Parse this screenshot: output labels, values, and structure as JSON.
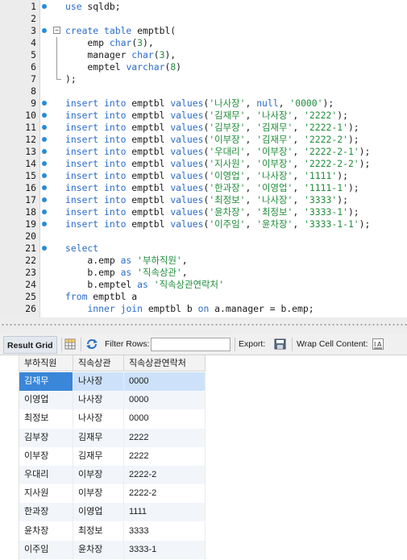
{
  "editor": {
    "lines": [
      {
        "n": "1",
        "dot": true,
        "tokens": [
          [
            "kw",
            "use"
          ],
          [
            "pl",
            " sqldb;"
          ]
        ]
      },
      {
        "n": "2",
        "dot": false,
        "tokens": []
      },
      {
        "n": "3",
        "dot": true,
        "fold": "−",
        "tokens": [
          [
            "kw",
            "create table"
          ],
          [
            "pl",
            " emptbl("
          ]
        ]
      },
      {
        "n": "4",
        "dot": false,
        "tokens": [
          [
            "pl",
            "    emp "
          ],
          [
            "kw",
            "char"
          ],
          [
            "pl",
            "("
          ],
          [
            "str",
            "3"
          ],
          [
            "pl",
            "),"
          ]
        ]
      },
      {
        "n": "5",
        "dot": false,
        "tokens": [
          [
            "pl",
            "    manager "
          ],
          [
            "kw",
            "char"
          ],
          [
            "pl",
            "("
          ],
          [
            "str",
            "3"
          ],
          [
            "pl",
            "),"
          ]
        ]
      },
      {
        "n": "6",
        "dot": false,
        "tokens": [
          [
            "pl",
            "    emptel "
          ],
          [
            "kw",
            "varchar"
          ],
          [
            "pl",
            "("
          ],
          [
            "str",
            "8"
          ],
          [
            "pl",
            ")"
          ]
        ]
      },
      {
        "n": "7",
        "dot": false,
        "tokens": [
          [
            "pl",
            ");"
          ]
        ]
      },
      {
        "n": "8",
        "dot": false,
        "tokens": []
      },
      {
        "n": "9",
        "dot": true,
        "tokens": [
          [
            "kw",
            "insert into"
          ],
          [
            "pl",
            " emptbl "
          ],
          [
            "kw",
            "values"
          ],
          [
            "pl",
            "("
          ],
          [
            "str",
            "'나사장'"
          ],
          [
            "pl",
            ", "
          ],
          [
            "kw",
            "null"
          ],
          [
            "pl",
            ", "
          ],
          [
            "str",
            "'0000'"
          ],
          [
            "pl",
            ");"
          ]
        ]
      },
      {
        "n": "10",
        "dot": true,
        "tokens": [
          [
            "kw",
            "insert into"
          ],
          [
            "pl",
            " emptbl "
          ],
          [
            "kw",
            "values"
          ],
          [
            "pl",
            "("
          ],
          [
            "str",
            "'김재무'"
          ],
          [
            "pl",
            ", "
          ],
          [
            "str",
            "'나사장'"
          ],
          [
            "pl",
            ", "
          ],
          [
            "str",
            "'2222'"
          ],
          [
            "pl",
            ");"
          ]
        ]
      },
      {
        "n": "11",
        "dot": true,
        "tokens": [
          [
            "kw",
            "insert into"
          ],
          [
            "pl",
            " emptbl "
          ],
          [
            "kw",
            "values"
          ],
          [
            "pl",
            "("
          ],
          [
            "str",
            "'김부장'"
          ],
          [
            "pl",
            ", "
          ],
          [
            "str",
            "'김재무'"
          ],
          [
            "pl",
            ", "
          ],
          [
            "str",
            "'2222-1'"
          ],
          [
            "pl",
            ");"
          ]
        ]
      },
      {
        "n": "12",
        "dot": true,
        "tokens": [
          [
            "kw",
            "insert into"
          ],
          [
            "pl",
            " emptbl "
          ],
          [
            "kw",
            "values"
          ],
          [
            "pl",
            "("
          ],
          [
            "str",
            "'이부장'"
          ],
          [
            "pl",
            ", "
          ],
          [
            "str",
            "'김재무'"
          ],
          [
            "pl",
            ", "
          ],
          [
            "str",
            "'2222-2'"
          ],
          [
            "pl",
            ");"
          ]
        ]
      },
      {
        "n": "13",
        "dot": true,
        "tokens": [
          [
            "kw",
            "insert into"
          ],
          [
            "pl",
            " emptbl "
          ],
          [
            "kw",
            "values"
          ],
          [
            "pl",
            "("
          ],
          [
            "str",
            "'우대리'"
          ],
          [
            "pl",
            ", "
          ],
          [
            "str",
            "'이부장'"
          ],
          [
            "pl",
            ", "
          ],
          [
            "str",
            "'2222-2-1'"
          ],
          [
            "pl",
            ");"
          ]
        ]
      },
      {
        "n": "14",
        "dot": true,
        "tokens": [
          [
            "kw",
            "insert into"
          ],
          [
            "pl",
            " emptbl "
          ],
          [
            "kw",
            "values"
          ],
          [
            "pl",
            "("
          ],
          [
            "str",
            "'지사원'"
          ],
          [
            "pl",
            ", "
          ],
          [
            "str",
            "'이부장'"
          ],
          [
            "pl",
            ", "
          ],
          [
            "str",
            "'2222-2-2'"
          ],
          [
            "pl",
            ");"
          ]
        ]
      },
      {
        "n": "15",
        "dot": true,
        "tokens": [
          [
            "kw",
            "insert into"
          ],
          [
            "pl",
            " emptbl "
          ],
          [
            "kw",
            "values"
          ],
          [
            "pl",
            "("
          ],
          [
            "str",
            "'이영업'"
          ],
          [
            "pl",
            ", "
          ],
          [
            "str",
            "'나사장'"
          ],
          [
            "pl",
            ", "
          ],
          [
            "str",
            "'1111'"
          ],
          [
            "pl",
            ");"
          ]
        ]
      },
      {
        "n": "16",
        "dot": true,
        "tokens": [
          [
            "kw",
            "insert into"
          ],
          [
            "pl",
            " emptbl "
          ],
          [
            "kw",
            "values"
          ],
          [
            "pl",
            "("
          ],
          [
            "str",
            "'한과장'"
          ],
          [
            "pl",
            ", "
          ],
          [
            "str",
            "'이영업'"
          ],
          [
            "pl",
            ", "
          ],
          [
            "str",
            "'1111-1'"
          ],
          [
            "pl",
            ");"
          ]
        ]
      },
      {
        "n": "17",
        "dot": true,
        "tokens": [
          [
            "kw",
            "insert into"
          ],
          [
            "pl",
            " emptbl "
          ],
          [
            "kw",
            "values"
          ],
          [
            "pl",
            "("
          ],
          [
            "str",
            "'최정보'"
          ],
          [
            "pl",
            ", "
          ],
          [
            "str",
            "'나사장'"
          ],
          [
            "pl",
            ", "
          ],
          [
            "str",
            "'3333'"
          ],
          [
            "pl",
            ");"
          ]
        ]
      },
      {
        "n": "18",
        "dot": true,
        "tokens": [
          [
            "kw",
            "insert into"
          ],
          [
            "pl",
            " emptbl "
          ],
          [
            "kw",
            "values"
          ],
          [
            "pl",
            "("
          ],
          [
            "str",
            "'윤차장'"
          ],
          [
            "pl",
            ", "
          ],
          [
            "str",
            "'최정보'"
          ],
          [
            "pl",
            ", "
          ],
          [
            "str",
            "'3333-1'"
          ],
          [
            "pl",
            ");"
          ]
        ]
      },
      {
        "n": "19",
        "dot": true,
        "tokens": [
          [
            "kw",
            "insert into"
          ],
          [
            "pl",
            " emptbl "
          ],
          [
            "kw",
            "values"
          ],
          [
            "pl",
            "("
          ],
          [
            "str",
            "'이주임'"
          ],
          [
            "pl",
            ", "
          ],
          [
            "str",
            "'윤차장'"
          ],
          [
            "pl",
            ", "
          ],
          [
            "str",
            "'3333-1-1'"
          ],
          [
            "pl",
            ");"
          ]
        ]
      },
      {
        "n": "20",
        "dot": false,
        "tokens": []
      },
      {
        "n": "21",
        "dot": true,
        "tokens": [
          [
            "kw",
            "select"
          ]
        ]
      },
      {
        "n": "22",
        "dot": false,
        "tokens": [
          [
            "pl",
            "    a.emp "
          ],
          [
            "kw",
            "as"
          ],
          [
            "pl",
            " "
          ],
          [
            "str",
            "'부하직원'"
          ],
          [
            "pl",
            ","
          ]
        ]
      },
      {
        "n": "23",
        "dot": false,
        "tokens": [
          [
            "pl",
            "    b.emp "
          ],
          [
            "kw",
            "as"
          ],
          [
            "pl",
            " "
          ],
          [
            "str",
            "'직속상관'"
          ],
          [
            "pl",
            ","
          ]
        ]
      },
      {
        "n": "24",
        "dot": false,
        "tokens": [
          [
            "pl",
            "    b.emptel "
          ],
          [
            "kw",
            "as"
          ],
          [
            "pl",
            " "
          ],
          [
            "str",
            "'직속상관연락처'"
          ]
        ]
      },
      {
        "n": "25",
        "dot": false,
        "tokens": [
          [
            "kw",
            "from"
          ],
          [
            "pl",
            " emptbl a"
          ]
        ]
      },
      {
        "n": "26",
        "dot": false,
        "tokens": [
          [
            "pl",
            "    "
          ],
          [
            "kw",
            "inner join"
          ],
          [
            "pl",
            " emptbl b "
          ],
          [
            "kw",
            "on"
          ],
          [
            "pl",
            " a.manager = b.emp;"
          ]
        ]
      }
    ]
  },
  "toolbar": {
    "result_grid": "Result Grid",
    "filter_rows": "Filter Rows:",
    "filter_value": "",
    "export": "Export:",
    "wrap": "Wrap Cell Content:"
  },
  "grid": {
    "headers": [
      "부하직원",
      "직속상관",
      "직속상관연락처"
    ],
    "rows": [
      [
        "김재무",
        "나사장",
        "0000"
      ],
      [
        "이영업",
        "나사장",
        "0000"
      ],
      [
        "최정보",
        "나사장",
        "0000"
      ],
      [
        "김부장",
        "김재무",
        "2222"
      ],
      [
        "이부장",
        "김재무",
        "2222"
      ],
      [
        "우대리",
        "이부장",
        "2222-2"
      ],
      [
        "지사원",
        "이부장",
        "2222-2"
      ],
      [
        "한과장",
        "이영업",
        "1111"
      ],
      [
        "윤차장",
        "최정보",
        "3333"
      ],
      [
        "이주임",
        "윤차장",
        "3333-1"
      ]
    ],
    "selected_row": 0
  },
  "colors": {
    "keyword": "#2b6cc9",
    "string": "#1f8c3a",
    "selection": "#3a86d8"
  }
}
